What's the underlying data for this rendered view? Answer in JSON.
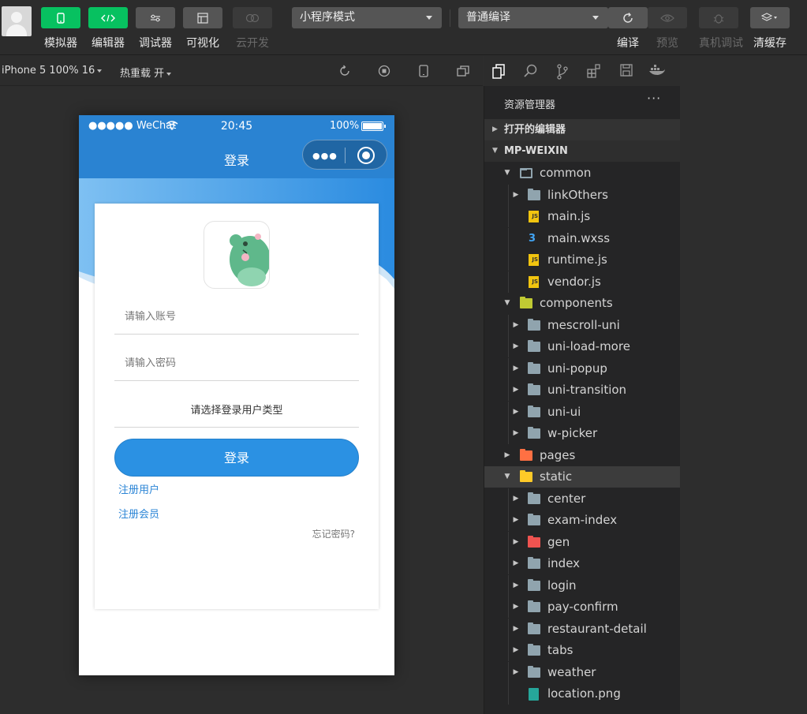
{
  "toolbar": {
    "simulator": "模拟器",
    "editor": "编辑器",
    "debugger": "调试器",
    "visual": "可视化",
    "cloud": "云开发",
    "mode": "小程序模式",
    "compile_mode": "普通编译",
    "compile": "编译",
    "preview": "预览",
    "device_debug": "真机调试",
    "clear_cache": "清缓存"
  },
  "simbar": {
    "device": "iPhone 5 100% 16",
    "hot_reload": "热重载 开"
  },
  "phone": {
    "carrier": "●●●●● WeChat",
    "time": "20:45",
    "battery": "100%",
    "nav_title": "登录",
    "capsule_dots": "●●●",
    "account_placeholder": "请输入账号",
    "password_placeholder": "请输入密码",
    "user_type": "请选择登录用户类型",
    "login_button": "登录",
    "register_user": "注册用户",
    "register_member": "注册会员",
    "forgot_password": "忘记密码?"
  },
  "explorer": {
    "title": "资源管理器",
    "more": "···",
    "open_editors": "打开的编辑器",
    "project": "MP-WEIXIN",
    "tree": [
      {
        "label": "common"
      },
      {
        "label": "linkOthers"
      },
      {
        "label": "main.js"
      },
      {
        "label": "main.wxss"
      },
      {
        "label": "runtime.js"
      },
      {
        "label": "vendor.js"
      },
      {
        "label": "components"
      },
      {
        "label": "mescroll-uni"
      },
      {
        "label": "uni-load-more"
      },
      {
        "label": "uni-popup"
      },
      {
        "label": "uni-transition"
      },
      {
        "label": "uni-ui"
      },
      {
        "label": "w-picker"
      },
      {
        "label": "pages"
      },
      {
        "label": "static"
      },
      {
        "label": "center"
      },
      {
        "label": "exam-index"
      },
      {
        "label": "gen"
      },
      {
        "label": "index"
      },
      {
        "label": "login"
      },
      {
        "label": "pay-confirm"
      },
      {
        "label": "restaurant-detail"
      },
      {
        "label": "tabs"
      },
      {
        "label": "weather"
      },
      {
        "label": "location.png"
      }
    ]
  },
  "colors": {
    "accent_green": "#07c160",
    "nav_blue": "#2a83d2",
    "button_blue": "#2b91e3"
  }
}
